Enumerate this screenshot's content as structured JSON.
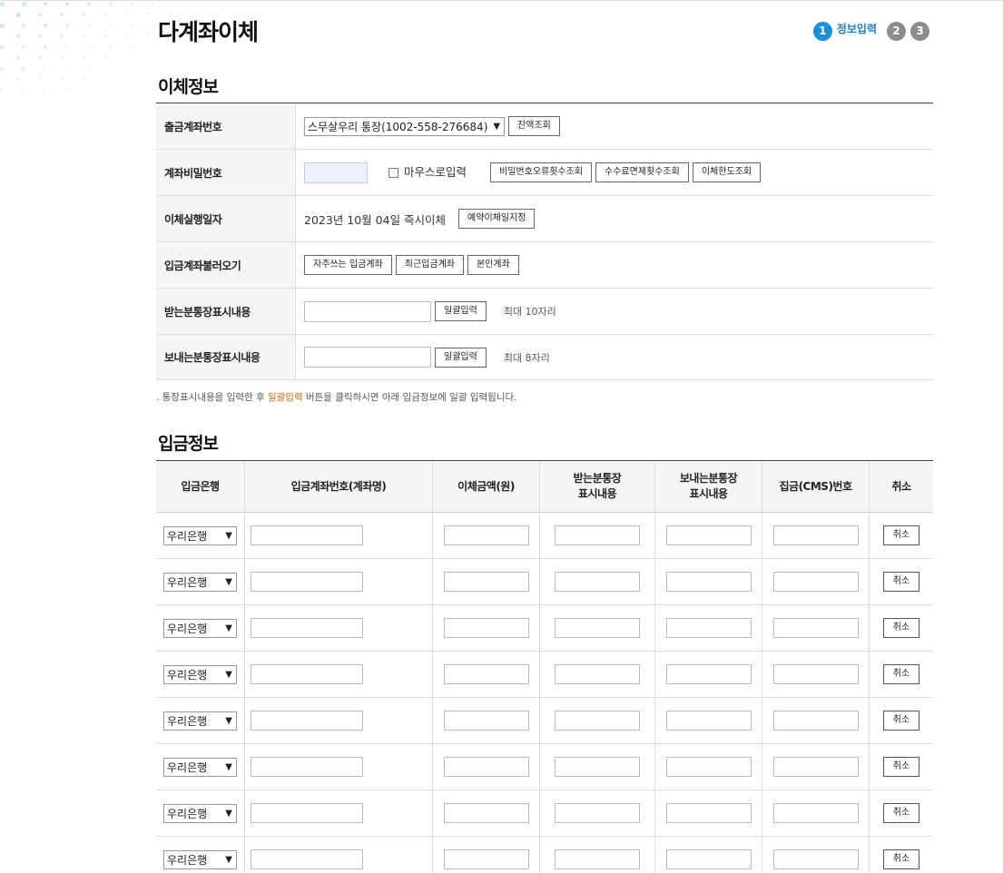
{
  "page": {
    "title": "다계좌이체",
    "steps": [
      {
        "num": "1",
        "label": "정보입력"
      },
      {
        "num": "2"
      },
      {
        "num": "3"
      }
    ]
  },
  "transfer_info": {
    "section_title": "이체정보",
    "withdraw_account": {
      "label": "출금계좌번호",
      "selected": "스무살우리 통장(1002-558-276684)",
      "balance_button": "잔액조회"
    },
    "password": {
      "label": "계좌비밀번호",
      "mouse_input_label": "마우스로입력",
      "buttons": [
        "비밀번호오류횟수조회",
        "수수료면제횟수조회",
        "이체한도조회"
      ]
    },
    "execution_date": {
      "label": "이체실행일자",
      "value": "2023년 10월 04일 즉시이체",
      "button": "예약이체일지정"
    },
    "load_account": {
      "label": "입금계좌불러오기",
      "buttons": [
        "자주쓰는 입금계좌",
        "최근입금계좌",
        "본인계좌"
      ]
    },
    "receiver_memo": {
      "label": "받는분통장표시내용",
      "button": "일괄입력",
      "hint": "최대 10자리"
    },
    "sender_memo": {
      "label": "보내는분통장표시내용",
      "button": "일괄입력",
      "hint": "최대 8자리"
    },
    "note_prefix": ". 통장표시내용을 입력한 후 ",
    "note_emphasis": "일괄입력",
    "note_suffix": " 버튼을 클릭하시면 아래 입금정보에 일괄 입력됩니다.",
    "note_color": "#d2621b"
  },
  "deposit_info": {
    "section_title": "입금정보",
    "columns": [
      "입금은행",
      "입금계좌번호(계좌명)",
      "이체금액(원)",
      "받는분통장\n표시내용",
      "보내는분통장\n표시내용",
      "집금(CMS)번호",
      "취소"
    ],
    "rows": [
      {
        "bank": "우리은행",
        "cancel": "취소"
      },
      {
        "bank": "우리은행",
        "cancel": "취소"
      },
      {
        "bank": "우리은행",
        "cancel": "취소"
      },
      {
        "bank": "우리은행",
        "cancel": "취소"
      },
      {
        "bank": "우리은행",
        "cancel": "취소"
      },
      {
        "bank": "우리은행",
        "cancel": "취소"
      },
      {
        "bank": "우리은행",
        "cancel": "취소"
      },
      {
        "bank": "우리은행",
        "cancel": "취소"
      }
    ]
  },
  "colors": {
    "accent": "#1e90d6",
    "step_inactive": "#8c8c8c",
    "header_bg": "#f5f5f5"
  }
}
